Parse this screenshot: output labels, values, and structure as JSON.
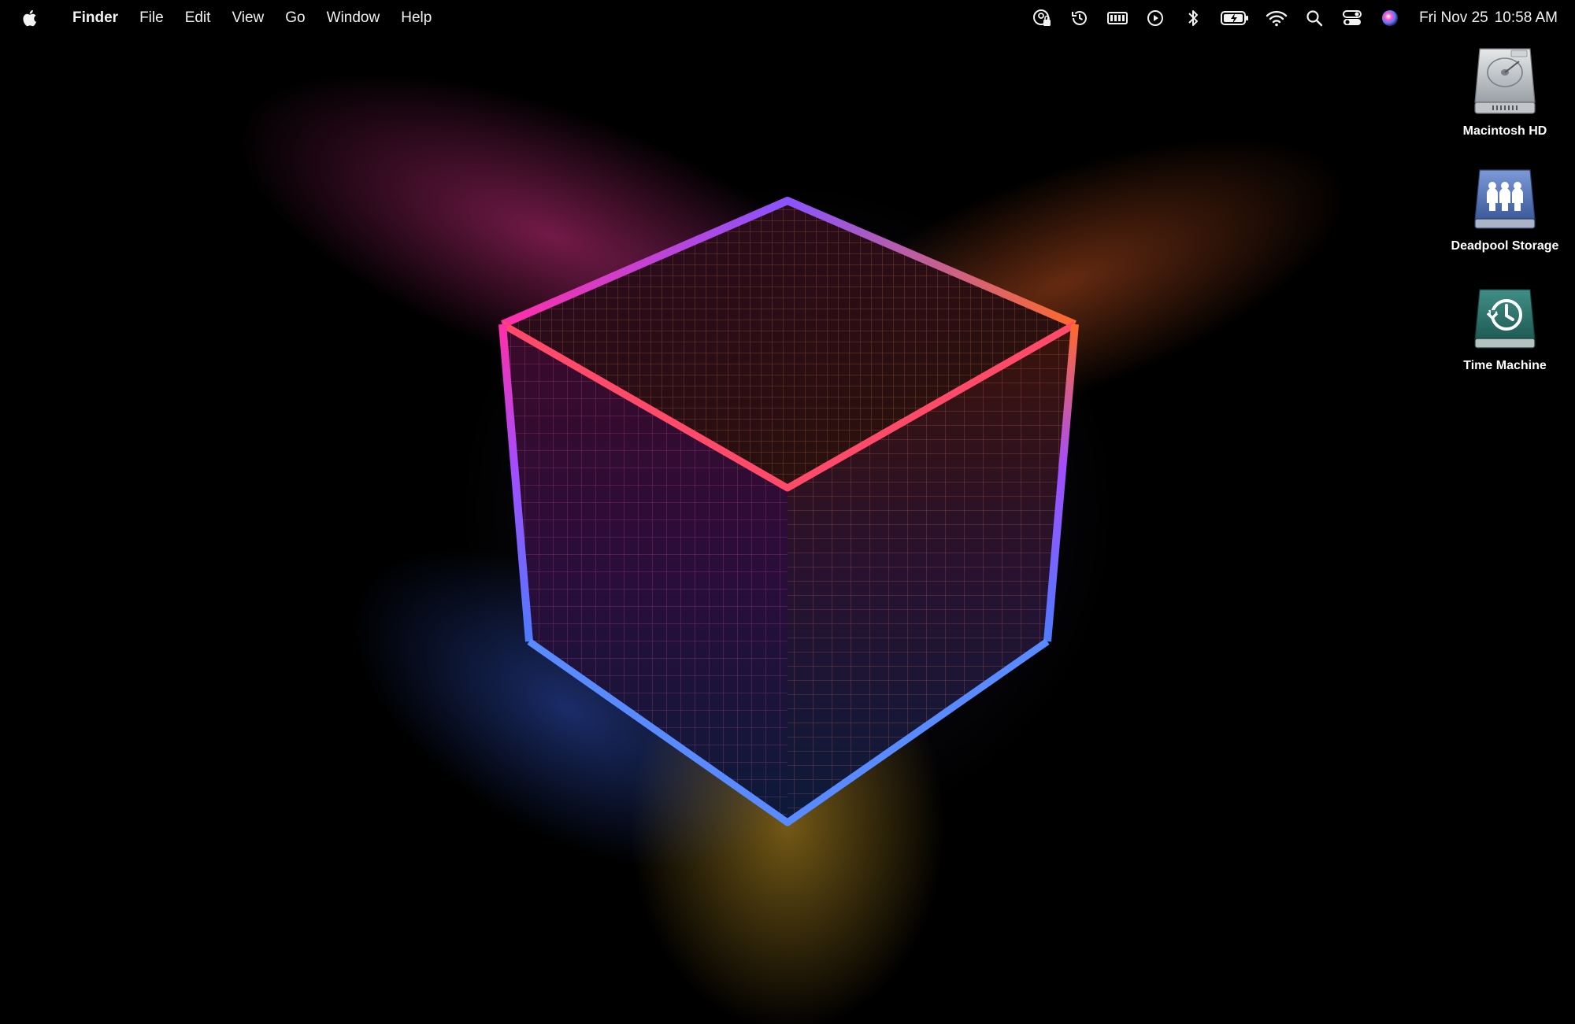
{
  "menubar": {
    "app_name": "Finder",
    "menus": [
      "File",
      "Edit",
      "View",
      "Go",
      "Window",
      "Help"
    ],
    "status_icons": [
      "screen-lock-icon",
      "time-machine-icon",
      "memory-icon",
      "play-icon",
      "bluetooth-icon",
      "battery-charging-icon",
      "wifi-icon",
      "search-icon",
      "control-center-icon",
      "siri-icon"
    ],
    "clock": {
      "date": "Fri Nov 25",
      "time": "10:58 AM"
    }
  },
  "desktop_icons": [
    {
      "label": "Macintosh HD",
      "icon": "hard-drive-icon"
    },
    {
      "label": "Deadpool Storage",
      "icon": "network-storage-icon"
    },
    {
      "label": "Time Machine",
      "icon": "time-machine-drive-icon"
    }
  ],
  "colors": {
    "cube_magenta": "#ff2fa8",
    "cube_orange": "#ff6a2a",
    "cube_yellow": "#ffc431",
    "cube_blue": "#4f7bff",
    "cube_purple": "#a34dff"
  }
}
